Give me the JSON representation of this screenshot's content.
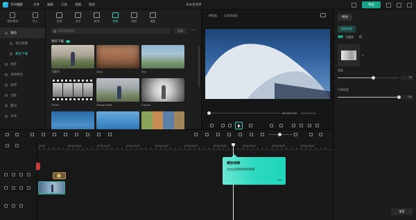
{
  "app": {
    "logo_text": "万兴喵影",
    "menu": [
      "文件",
      "编辑",
      "工具",
      "视图",
      "帮助"
    ],
    "project_title": "未命名项目",
    "export_label": "导出"
  },
  "sidebar": {
    "tabs": [
      {
        "label": "我的素材",
        "icon": "folder-icon"
      },
      {
        "label": "导入",
        "icon": "import-icon"
      }
    ],
    "items": [
      {
        "label": "我的",
        "icon": "star-icon",
        "state": "active"
      },
      {
        "label": "我的收藏",
        "icon": "heart-icon",
        "state": "sub"
      },
      {
        "label": "我的下载",
        "icon": "download-icon",
        "state": "sub-active"
      },
      {
        "label": "推荐",
        "icon": "thumb-icon",
        "state": ""
      },
      {
        "label": "视频特效",
        "icon": "fx-icon",
        "state": ""
      },
      {
        "label": "滤镜",
        "icon": "filter-icon",
        "state": ""
      },
      {
        "label": "边框",
        "icon": "frame-icon",
        "state": ""
      },
      {
        "label": "叠加",
        "icon": "overlay-icon",
        "state": ""
      },
      {
        "label": "光效",
        "icon": "light-icon",
        "state": ""
      }
    ]
  },
  "media": {
    "tabs": [
      {
        "label": "音频",
        "icon": "music-icon"
      },
      {
        "label": "文字",
        "icon": "text-icon"
      },
      {
        "label": "转场",
        "icon": "transition-icon"
      },
      {
        "label": "特效",
        "icon": "effects-icon"
      },
      {
        "label": "贴纸",
        "icon": "sticker-icon"
      },
      {
        "label": "模板",
        "icon": "template-icon"
      }
    ],
    "active_tab": 3,
    "search_placeholder": "搜索视频特效",
    "filter_label": "全部",
    "section_title": "我的下载",
    "section_badge": "2",
    "thumbnails": [
      {
        "label": "马赛克",
        "style": "t-outdoor"
      },
      {
        "label": "Glow",
        "style": "t-retro"
      },
      {
        "label": "Sky",
        "style": "t-blue"
      },
      {
        "label": "Trinall",
        "style": "t-film"
      },
      {
        "label": "Strong Glitch",
        "style": "t-strong"
      },
      {
        "label": "Cancel",
        "style": "t-cancel"
      },
      {
        "label": "",
        "style": "t-sky"
      },
      {
        "label": "",
        "style": "t-sky2"
      },
      {
        "label": "",
        "style": "t-colors"
      }
    ]
  },
  "preview": {
    "quality_label": "播放器",
    "ratio_label": "全高清画质",
    "current_time": "00:00:00:00",
    "total_time": "00:00:05:00"
  },
  "properties": {
    "tab_label": "特效",
    "sub_tab_label": "视频特效",
    "toggle_label": "马赛克",
    "opacity_label": "强度",
    "opacity_value": "50",
    "opacity_fraction": 0.58,
    "amount_label": "不透明度",
    "amount_value": "100",
    "amount_fraction": 1.0,
    "apply_label": "重置"
  },
  "timeline": {
    "ticks": [
      "00:00",
      "00:00:05:00",
      "00:00:10:00",
      "00:00:15:00",
      "00:00:20:00",
      "00:00:25:00",
      "00:00:30:00",
      "00:00:35:00",
      "00:00:40:00",
      "00:00:45:00"
    ],
    "zoom_fraction": 0.42
  },
  "tooltip": {
    "title": "播放视频",
    "body": "点击这里预览你的视频",
    "page": "4/4"
  }
}
